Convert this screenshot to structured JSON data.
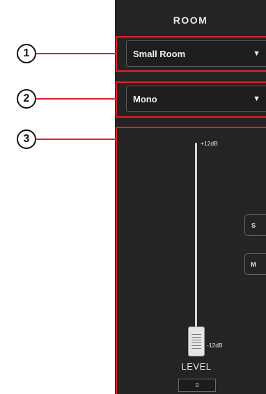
{
  "panel": {
    "title": "ROOM"
  },
  "callouts": [
    "1",
    "2",
    "3"
  ],
  "room_select": {
    "value": "Small Room",
    "caret": "▼"
  },
  "mode_select": {
    "value": "Mono",
    "caret": "▼"
  },
  "fader": {
    "max_label": "+12dB",
    "min_label": "-12dB",
    "label": "LEVEL",
    "value": "0"
  },
  "buttons": {
    "solo": "S",
    "mute": "M"
  },
  "colors": {
    "callout": "#e2202c",
    "panel_bg": "#242424"
  }
}
